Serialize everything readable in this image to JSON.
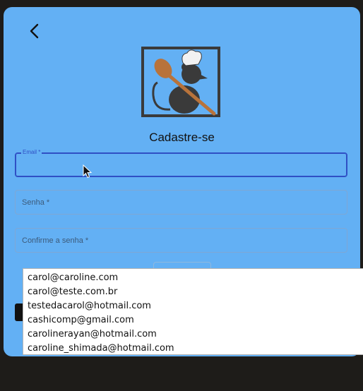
{
  "page": {
    "title": "Cadastre-se"
  },
  "icons": {
    "back": "arrow-back-icon",
    "logo": "chef-rat-logo"
  },
  "form": {
    "email": {
      "label": "Email *",
      "value": ""
    },
    "password": {
      "placeholder": "Senha *"
    },
    "confirm_password": {
      "placeholder": "Confirme a senha *"
    }
  },
  "autocomplete": {
    "suggestions": [
      "carol@caroline.com",
      "carol@teste.com.br",
      "testedacarol@hotmail.com",
      "cashicomp@gmail.com",
      "carolinerayan@hotmail.com",
      "caroline_shimada@hotmail.com"
    ]
  },
  "colors": {
    "background": "#1e1c19",
    "card": "#63b0f4",
    "focus": "#2f4fc4"
  }
}
